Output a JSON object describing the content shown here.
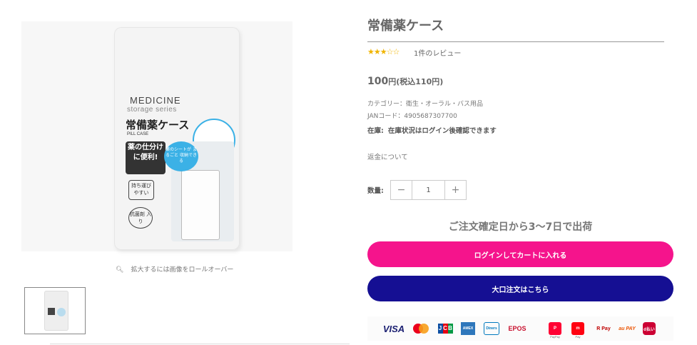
{
  "product": {
    "title": "常備薬ケース",
    "rating_stars": "★★★☆☆",
    "review_count": "1件のレビュー",
    "price": "100",
    "price_unit": "円(税込110円)",
    "category": "カテゴリー：衛生・オーラル・バス用品",
    "jan": "JANコード：4905687307700",
    "stock_label": "在庫:",
    "stock_value": "在庫状況はログイン後確認できます",
    "refund_link": "返金について",
    "qty_label": "数量:",
    "qty_value": "1",
    "qty_minus": "−",
    "qty_plus": "+",
    "shipping_note": "ご注文確定日から3〜7日で出荷",
    "login_button": "ログインしてカートに入れる",
    "bulk_button": "大口注文はこちら"
  },
  "gallery": {
    "zoom_hint": "拡大するには画像をロールオーバー",
    "package": {
      "brand": "MEDICINE",
      "series": "storage series",
      "name": "常備薬ケース",
      "sub": "PILL CASE",
      "badge": "薬の仕分けに便利!",
      "badge2": "持ち運び やすい",
      "badge3": "抗菌剤 入り",
      "bubble": "薬のシートが まるごと 収納できる"
    }
  },
  "payments": {
    "visa": "VISA",
    "jcb": [
      "J",
      "C",
      "B"
    ],
    "amex": "AMEX",
    "diners": "Diners",
    "epos": "EPOS",
    "paypay": "PayPay",
    "merpay": "Pay",
    "rpay": "R Pay",
    "aupay": "au PAY",
    "dpay": "d払い",
    "colors": {
      "jcb": [
        "#0b4ea2",
        "#e60012",
        "#009944"
      ]
    }
  },
  "colors": {
    "login_button": "#f5148c",
    "bulk_button": "#150f93",
    "star": "#f0b400"
  }
}
